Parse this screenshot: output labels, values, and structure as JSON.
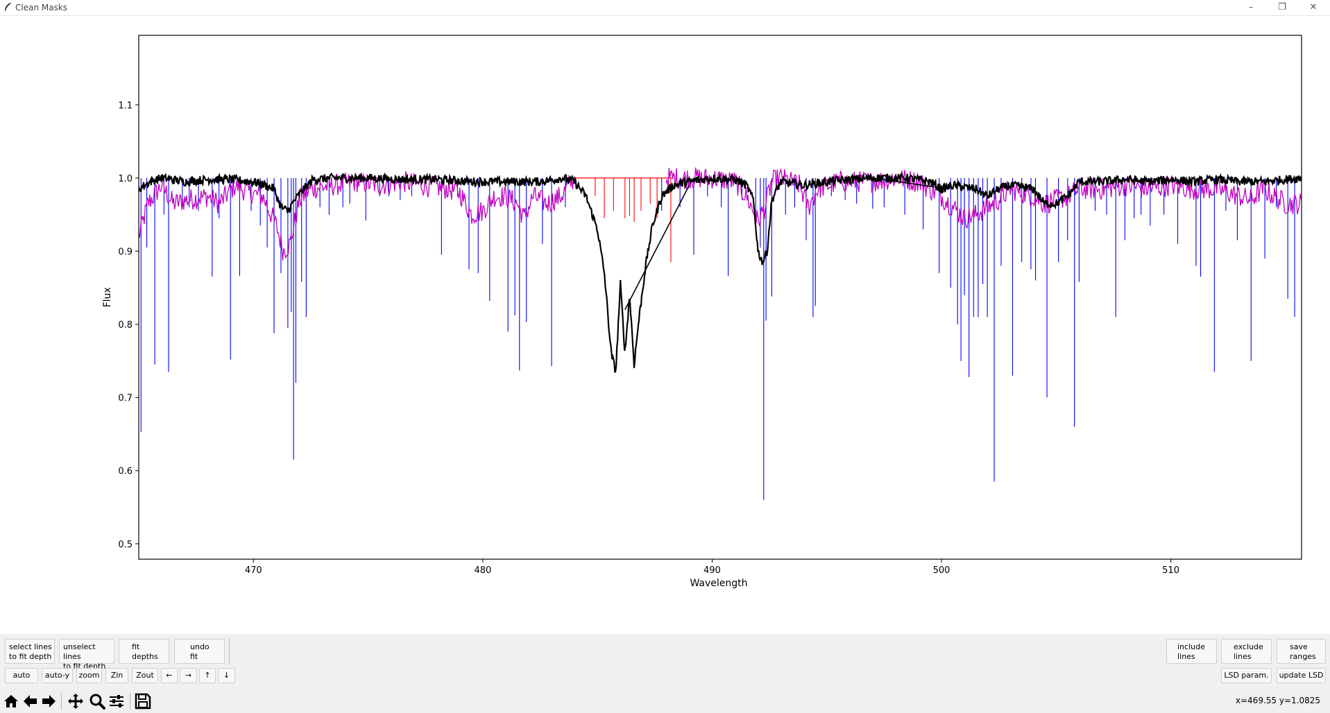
{
  "window": {
    "title": "Clean Masks",
    "minimize_glyph": "–",
    "restore_glyph": "❐",
    "close_glyph": "✕"
  },
  "chart_data": {
    "type": "line",
    "xlabel": "Wavelength",
    "ylabel": "Flux",
    "xlim": [
      465.0,
      515.7
    ],
    "ylim": [
      0.479,
      1.195
    ],
    "x_ticks": [
      470,
      480,
      490,
      500,
      510
    ],
    "y_ticks": [
      0.5,
      0.6,
      0.7,
      0.8,
      0.9,
      1.0,
      1.1
    ],
    "grid": false,
    "colors": {
      "lines": "#0000ff",
      "excluded_lines": "#ff0000",
      "model": "#c000c0",
      "observed": "#000000"
    },
    "mask_lines": [
      [
        465.1,
        0.653
      ],
      [
        465.35,
        0.905
      ],
      [
        465.7,
        0.745
      ],
      [
        466.1,
        0.95
      ],
      [
        466.3,
        0.735
      ],
      [
        466.9,
        0.96
      ],
      [
        467.2,
        0.96
      ],
      [
        467.6,
        0.955
      ],
      [
        468.2,
        0.865
      ],
      [
        468.5,
        0.945
      ],
      [
        469.0,
        0.752
      ],
      [
        469.4,
        0.866
      ],
      [
        469.9,
        0.955
      ],
      [
        470.3,
        0.935
      ],
      [
        470.6,
        0.905
      ],
      [
        470.9,
        0.788
      ],
      [
        471.2,
        0.87
      ],
      [
        471.5,
        0.795
      ],
      [
        471.65,
        0.817
      ],
      [
        471.75,
        0.615
      ],
      [
        471.85,
        0.72
      ],
      [
        472.1,
        0.858
      ],
      [
        472.3,
        0.81
      ],
      [
        472.9,
        0.96
      ],
      [
        473.3,
        0.95
      ],
      [
        473.9,
        0.96
      ],
      [
        474.2,
        0.965
      ],
      [
        474.9,
        0.942
      ],
      [
        475.5,
        0.975
      ],
      [
        475.9,
        0.975
      ],
      [
        476.4,
        0.97
      ],
      [
        476.9,
        0.975
      ],
      [
        478.2,
        0.895
      ],
      [
        478.9,
        0.975
      ],
      [
        479.4,
        0.875
      ],
      [
        479.8,
        0.87
      ],
      [
        480.3,
        0.832
      ],
      [
        481.1,
        0.79
      ],
      [
        481.4,
        0.812
      ],
      [
        481.6,
        0.737
      ],
      [
        481.9,
        0.803
      ],
      [
        482.6,
        0.91
      ],
      [
        483.0,
        0.743
      ],
      [
        483.6,
        0.96
      ],
      [
        487.8,
        0.955
      ],
      [
        488.6,
        0.96
      ],
      [
        489.2,
        0.895
      ],
      [
        489.8,
        0.975
      ],
      [
        490.4,
        0.96
      ],
      [
        490.7,
        0.866
      ],
      [
        491.3,
        0.97
      ],
      [
        491.9,
        0.93
      ],
      [
        492.1,
        0.905
      ],
      [
        492.25,
        0.56
      ],
      [
        492.35,
        0.805
      ],
      [
        492.6,
        0.838
      ],
      [
        493.2,
        0.95
      ],
      [
        493.6,
        0.96
      ],
      [
        494.1,
        0.915
      ],
      [
        494.4,
        0.81
      ],
      [
        494.5,
        0.825
      ],
      [
        495.2,
        0.975
      ],
      [
        495.8,
        0.97
      ],
      [
        496.3,
        0.965
      ],
      [
        497.0,
        0.958
      ],
      [
        497.5,
        0.96
      ],
      [
        498.4,
        0.95
      ],
      [
        499.2,
        0.93
      ],
      [
        499.9,
        0.87
      ],
      [
        500.4,
        0.85
      ],
      [
        500.7,
        0.8
      ],
      [
        500.85,
        0.75
      ],
      [
        501.0,
        0.84
      ],
      [
        501.2,
        0.728
      ],
      [
        501.4,
        0.81
      ],
      [
        501.6,
        0.81
      ],
      [
        501.8,
        0.855
      ],
      [
        502.0,
        0.81
      ],
      [
        502.3,
        0.585
      ],
      [
        502.6,
        0.88
      ],
      [
        503.1,
        0.73
      ],
      [
        503.5,
        0.885
      ],
      [
        503.9,
        0.875
      ],
      [
        504.1,
        0.86
      ],
      [
        504.6,
        0.7
      ],
      [
        505.1,
        0.885
      ],
      [
        505.5,
        0.915
      ],
      [
        505.8,
        0.66
      ],
      [
        506.0,
        0.858
      ],
      [
        506.7,
        0.955
      ],
      [
        507.2,
        0.95
      ],
      [
        507.6,
        0.81
      ],
      [
        508.0,
        0.915
      ],
      [
        508.4,
        0.945
      ],
      [
        508.7,
        0.95
      ],
      [
        509.1,
        0.935
      ],
      [
        509.7,
        0.95
      ],
      [
        510.3,
        0.91
      ],
      [
        511.1,
        0.88
      ],
      [
        511.3,
        0.865
      ],
      [
        511.9,
        0.735
      ],
      [
        512.4,
        0.955
      ],
      [
        512.9,
        0.915
      ],
      [
        513.5,
        0.75
      ],
      [
        514.1,
        0.89
      ],
      [
        514.6,
        0.96
      ],
      [
        515.1,
        0.835
      ],
      [
        515.4,
        0.81
      ]
    ],
    "excluded_lines": [
      [
        484.9,
        0.975
      ],
      [
        485.3,
        0.945
      ],
      [
        485.7,
        0.955
      ],
      [
        486.2,
        0.945
      ],
      [
        486.4,
        0.948
      ],
      [
        486.6,
        0.94
      ],
      [
        486.9,
        0.955
      ],
      [
        487.3,
        0.965
      ],
      [
        487.6,
        0.945
      ],
      [
        488.2,
        0.885
      ]
    ],
    "model_anchors": [
      [
        465.0,
        0.92
      ],
      [
        465.4,
        0.965
      ],
      [
        466.0,
        0.99
      ],
      [
        466.5,
        0.965
      ],
      [
        467.1,
        0.97
      ],
      [
        468.0,
        0.975
      ],
      [
        468.5,
        0.965
      ],
      [
        469.2,
        0.99
      ],
      [
        469.8,
        0.98
      ],
      [
        470.4,
        0.975
      ],
      [
        471.0,
        0.935
      ],
      [
        471.3,
        0.9
      ],
      [
        471.6,
        0.91
      ],
      [
        472.0,
        0.97
      ],
      [
        472.5,
        0.985
      ],
      [
        473.5,
        0.99
      ],
      [
        474.5,
        0.995
      ],
      [
        475.5,
        0.99
      ],
      [
        476.5,
        0.995
      ],
      [
        477.5,
        0.99
      ],
      [
        478.5,
        0.985
      ],
      [
        479.0,
        0.98
      ],
      [
        479.5,
        0.95
      ],
      [
        480.0,
        0.955
      ],
      [
        480.5,
        0.975
      ],
      [
        481.0,
        0.975
      ],
      [
        481.5,
        0.965
      ],
      [
        481.8,
        0.945
      ],
      [
        482.2,
        0.975
      ],
      [
        482.8,
        0.965
      ],
      [
        483.4,
        0.975
      ],
      [
        484.0,
        1.0
      ],
      [
        485.0,
        1.0
      ],
      [
        488.0,
        1.0
      ],
      [
        490.0,
        1.0
      ],
      [
        491.0,
        0.995
      ],
      [
        491.5,
        0.975
      ],
      [
        492.0,
        0.94
      ],
      [
        492.3,
        0.96
      ],
      [
        492.6,
        0.995
      ],
      [
        493.0,
        1.0
      ],
      [
        493.8,
        0.99
      ],
      [
        494.2,
        0.96
      ],
      [
        494.6,
        0.985
      ],
      [
        495.5,
        0.995
      ],
      [
        497.0,
        0.995
      ],
      [
        498.0,
        1.0
      ],
      [
        499.0,
        0.995
      ],
      [
        500.0,
        0.975
      ],
      [
        500.5,
        0.96
      ],
      [
        501.0,
        0.945
      ],
      [
        501.5,
        0.95
      ],
      [
        502.0,
        0.96
      ],
      [
        502.5,
        0.97
      ],
      [
        503.0,
        0.985
      ],
      [
        504.0,
        0.975
      ],
      [
        504.5,
        0.965
      ],
      [
        505.0,
        0.97
      ],
      [
        505.5,
        0.975
      ],
      [
        506.0,
        0.985
      ],
      [
        507.0,
        0.985
      ],
      [
        508.0,
        0.99
      ],
      [
        509.0,
        0.985
      ],
      [
        510.0,
        0.99
      ],
      [
        511.0,
        0.985
      ],
      [
        512.0,
        0.985
      ],
      [
        513.0,
        0.975
      ],
      [
        513.5,
        0.97
      ],
      [
        514.0,
        0.985
      ],
      [
        514.5,
        0.975
      ],
      [
        515.0,
        0.965
      ],
      [
        515.5,
        0.965
      ]
    ],
    "observed_anchors": [
      [
        465.0,
        0.985
      ],
      [
        465.5,
        0.995
      ],
      [
        466.0,
        1.0
      ],
      [
        467.0,
        0.995
      ],
      [
        468.0,
        0.998
      ],
      [
        469.0,
        0.998
      ],
      [
        470.0,
        0.995
      ],
      [
        470.5,
        0.99
      ],
      [
        470.9,
        0.985
      ],
      [
        471.2,
        0.96
      ],
      [
        471.5,
        0.955
      ],
      [
        471.8,
        0.97
      ],
      [
        472.2,
        0.985
      ],
      [
        472.6,
        0.998
      ],
      [
        473.5,
        1.0
      ],
      [
        475.0,
        1.0
      ],
      [
        476.5,
        0.998
      ],
      [
        478.0,
        0.998
      ],
      [
        479.5,
        0.995
      ],
      [
        480.5,
        0.995
      ],
      [
        481.5,
        0.995
      ],
      [
        482.5,
        0.995
      ],
      [
        483.5,
        1.0
      ],
      [
        484.0,
        0.995
      ],
      [
        484.5,
        0.975
      ],
      [
        485.0,
        0.93
      ],
      [
        485.3,
        0.87
      ],
      [
        485.6,
        0.76
      ],
      [
        485.8,
        0.735
      ],
      [
        486.0,
        0.855
      ],
      [
        486.2,
        0.76
      ],
      [
        486.4,
        0.84
      ],
      [
        486.6,
        0.745
      ],
      [
        486.8,
        0.805
      ],
      [
        487.1,
        0.88
      ],
      [
        487.4,
        0.935
      ],
      [
        487.8,
        0.975
      ],
      [
        488.3,
        0.99
      ],
      [
        489.0,
        0.995
      ],
      [
        490.0,
        1.0
      ],
      [
        491.0,
        0.998
      ],
      [
        491.5,
        0.99
      ],
      [
        491.8,
        0.97
      ],
      [
        492.0,
        0.9
      ],
      [
        492.2,
        0.885
      ],
      [
        492.4,
        0.9
      ],
      [
        492.6,
        0.97
      ],
      [
        493.0,
        0.995
      ],
      [
        494.0,
        0.99
      ],
      [
        495.0,
        0.995
      ],
      [
        496.0,
        0.998
      ],
      [
        497.0,
        1.0
      ],
      [
        498.5,
        1.0
      ],
      [
        499.5,
        0.995
      ],
      [
        500.0,
        0.985
      ],
      [
        500.5,
        0.99
      ],
      [
        501.5,
        0.985
      ],
      [
        502.0,
        0.975
      ],
      [
        502.5,
        0.985
      ],
      [
        503.0,
        0.99
      ],
      [
        503.5,
        0.988
      ],
      [
        504.0,
        0.985
      ],
      [
        504.5,
        0.965
      ],
      [
        505.0,
        0.965
      ],
      [
        505.5,
        0.975
      ],
      [
        506.0,
        0.995
      ],
      [
        507.0,
        0.995
      ],
      [
        508.0,
        0.998
      ],
      [
        509.0,
        0.995
      ],
      [
        510.0,
        0.998
      ],
      [
        511.0,
        0.995
      ],
      [
        512.0,
        0.998
      ],
      [
        513.0,
        0.995
      ],
      [
        514.0,
        0.995
      ],
      [
        515.0,
        0.998
      ],
      [
        515.7,
        1.0
      ]
    ],
    "fit_segments": [
      [
        [
          486.2,
          0.82
        ],
        [
          489.0,
          0.99
        ]
      ],
      [
        [
          497.0,
          1.0
        ],
        [
          500.3,
          0.985
        ]
      ]
    ]
  },
  "toolbar": {
    "select_lines": "select lines\nto fit depth",
    "unselect_lines": "unselect lines\nto fit depth",
    "fit_depths": "fit\ndepths",
    "undo_fit": "undo\nfit",
    "auto": "auto",
    "auto_y": "auto-y",
    "zoom": "zoom",
    "zin": "Zin",
    "zout": "Zout",
    "left": "←",
    "right": "→",
    "up": "↑",
    "down": "↓",
    "include_lines": "include\nlines",
    "exclude_lines": "exclude\nlines",
    "save_ranges": "save\nranges",
    "lsd_param": "LSD param.",
    "update_lsd": "update LSD"
  },
  "nav": {
    "home": "home-icon",
    "back": "back-arrow-icon",
    "forward": "forward-arrow-icon",
    "pan": "pan-icon",
    "zoom": "zoom-icon",
    "configure": "configure-icon",
    "save": "save-icon"
  },
  "status": {
    "coords": "x=469.55 y=1.0825"
  }
}
